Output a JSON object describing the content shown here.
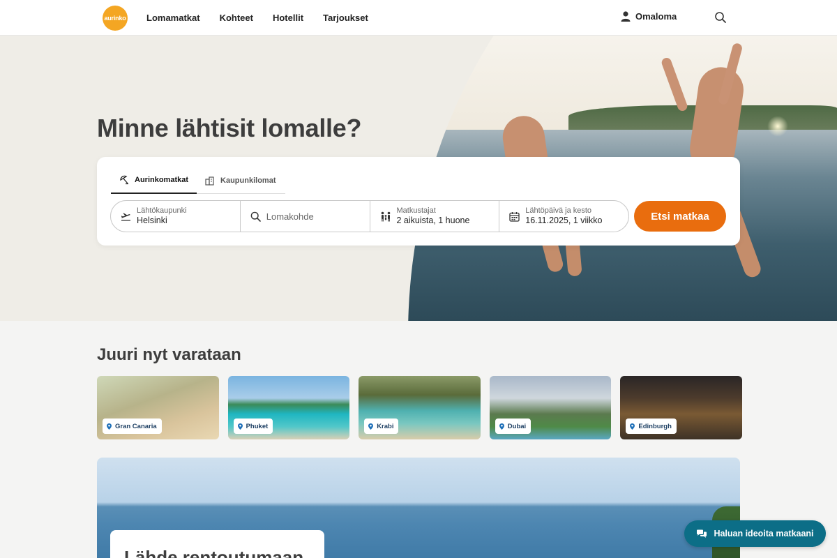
{
  "header": {
    "logo_text": "aurinko",
    "nav": [
      "Lomamatkat",
      "Kohteet",
      "Hotellit",
      "Tarjoukset"
    ],
    "account_label": "Omaloma"
  },
  "hero": {
    "title": "Minne lähtisit lomalle?"
  },
  "search": {
    "tabs": [
      {
        "label": "Aurinkomatkat",
        "icon": "beach-umbrella-icon",
        "active": true
      },
      {
        "label": "Kaupunkilomat",
        "icon": "city-icon",
        "active": false
      }
    ],
    "departure": {
      "label": "Lähtökaupunki",
      "value": "Helsinki"
    },
    "destination": {
      "placeholder": "Lomakohde"
    },
    "travelers": {
      "label": "Matkustajat",
      "value": "2 aikuista, 1 huone"
    },
    "date": {
      "label": "Lähtöpäivä ja kesto",
      "value": "16.11.2025, 1 viikko"
    },
    "submit_label": "Etsi matkaa"
  },
  "trending": {
    "title": "Juuri nyt varataan",
    "destinations": [
      "Gran Canaria",
      "Phuket",
      "Krabi",
      "Dubai",
      "Edinburgh"
    ]
  },
  "banner": {
    "title": "Lähde rentoutumaan"
  },
  "chat": {
    "label": "Haluan ideoita matkaani"
  },
  "colors": {
    "accent_orange": "#e96d0e",
    "logo_yellow": "#f4a623",
    "chat_teal": "#0c6e87",
    "tag_text": "#1d3f63"
  }
}
